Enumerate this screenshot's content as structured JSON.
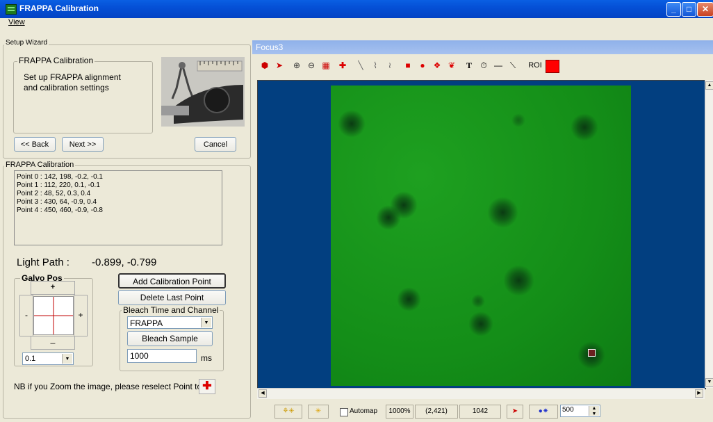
{
  "window": {
    "title": "FRAPPA Calibration"
  },
  "menu": {
    "view": "View"
  },
  "wizard": {
    "group_label": "Setup Wizard",
    "inner_label": "FRAPPA Calibration",
    "description": "Set up FRAPPA alignment and calibration settings",
    "back": "<< Back",
    "next": "Next >>",
    "cancel": "Cancel"
  },
  "calibration": {
    "group_label": "FRAPPA Calibration",
    "points": [
      "Point 0 : 142, 198, -0.2, -0.1",
      "Point 1 : 112, 220, 0.1, -0.1",
      "Point 2 : 48, 52, 0.3, 0.4",
      "Point 3 : 430, 64, -0.9, 0.4",
      "Point 4 : 450, 460, -0.9, -0.8"
    ],
    "light_path_label": "Light Path :",
    "light_path_value": "-0.899, -0.799",
    "galvo_label": "Galvo Pos",
    "galvo_up": "+",
    "galvo_down": "_",
    "galvo_left": "-",
    "galvo_right": "+",
    "step_value": "0.1",
    "add_point": "Add Calibration Point",
    "delete_point": "Delete Last Point",
    "bleach_group": "Bleach Time and Channel",
    "channel": "FRAPPA",
    "bleach_sample": "Bleach Sample",
    "bleach_time": "1000",
    "bleach_unit": "ms",
    "note": "NB if you Zoom the image, please reselect Point tool."
  },
  "focus": {
    "title": "Focus3",
    "roi_label": "ROI",
    "roi_color": "#ff0000"
  },
  "status": {
    "automap": "Automap",
    "zoom": "1000%",
    "coords": "(2,421)",
    "value": "1042",
    "spin_value": "500"
  }
}
